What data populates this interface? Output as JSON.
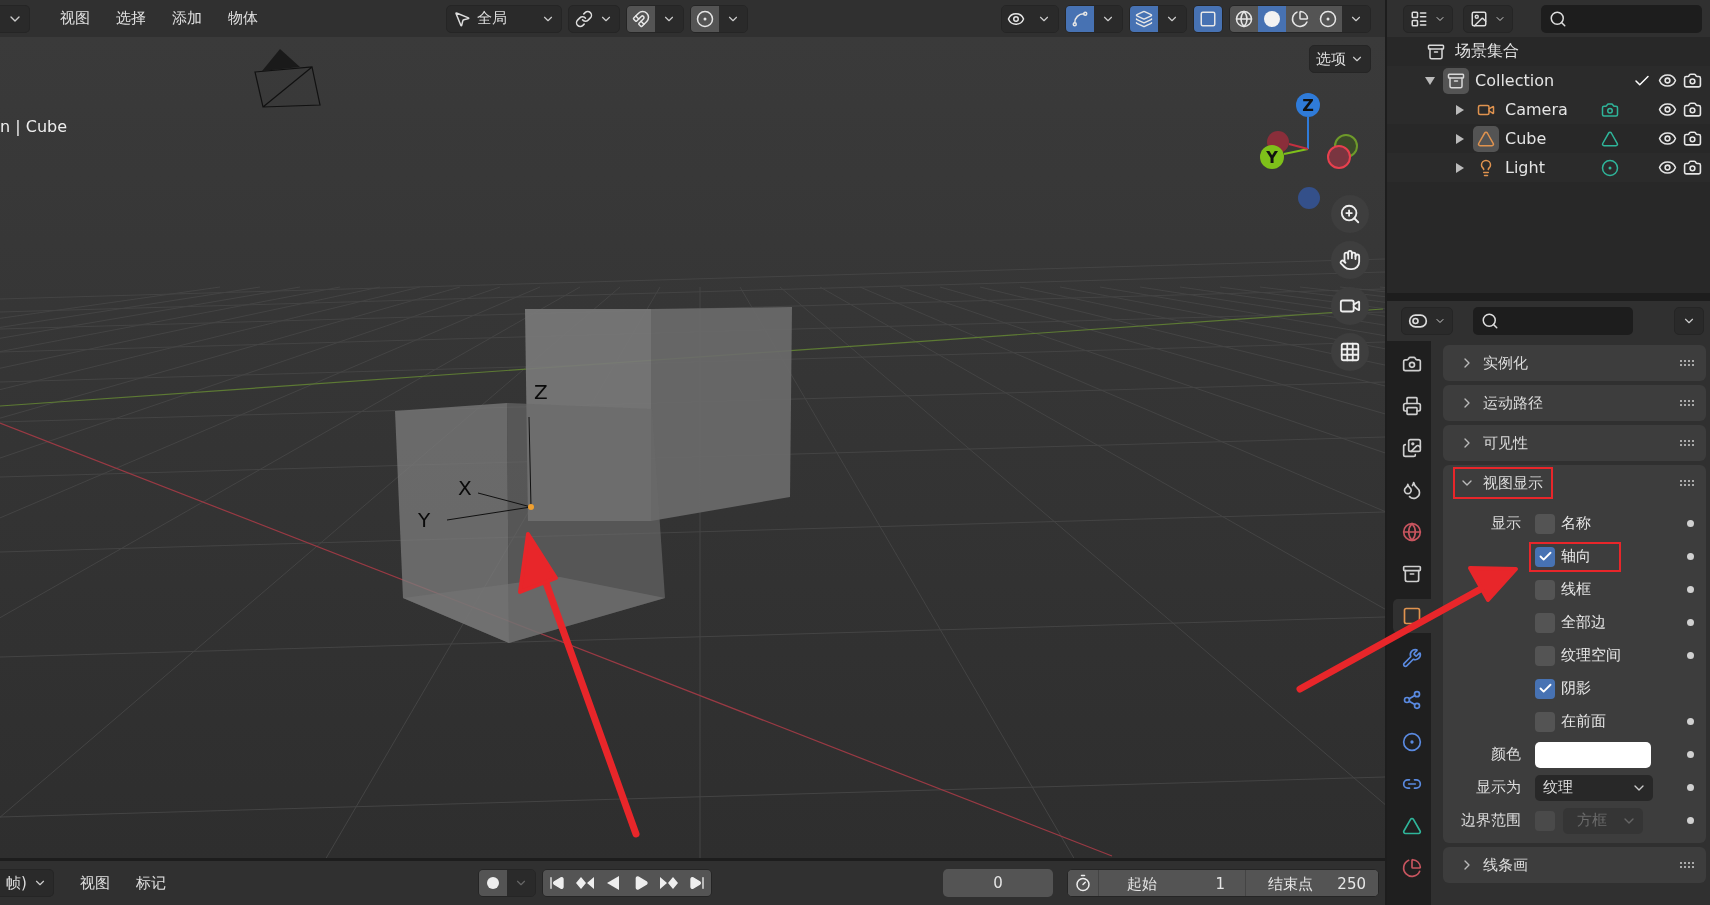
{
  "viewport": {
    "menus": [
      "视图",
      "选择",
      "添加",
      "物体"
    ],
    "orientation": "全局",
    "toggles": [
      {
        "kind": "snap",
        "on": false
      },
      {
        "kind": "proportional",
        "on": false
      },
      {
        "kind": "visibility",
        "on": false
      },
      {
        "kind": "gizmo",
        "on": true
      },
      {
        "kind": "overlays",
        "on": true
      },
      {
        "kind": "xray",
        "on": true
      }
    ],
    "shading": [
      {
        "kind": "wireframe",
        "selected": false
      },
      {
        "kind": "solid",
        "selected": true
      },
      {
        "kind": "material",
        "selected": false
      },
      {
        "kind": "rendered",
        "selected": false
      }
    ],
    "options_button": "选项",
    "object_label": "n | Cube",
    "object_axes": [
      "Z",
      "X",
      "Y"
    ],
    "gizmo_axes": [
      "Z",
      "Y"
    ]
  },
  "outliner": {
    "root": "场景集合",
    "items": [
      {
        "name": "Collection",
        "kind": "collection",
        "expanded": true,
        "checked": true,
        "active": true,
        "children": [
          {
            "name": "Camera",
            "kind": "camera",
            "expanded": false,
            "active": false
          },
          {
            "name": "Cube",
            "kind": "mesh",
            "expanded": false,
            "active": true
          },
          {
            "name": "Light",
            "kind": "light",
            "expanded": false,
            "active": false
          }
        ]
      }
    ]
  },
  "properties": {
    "tabs": [
      {
        "kind": "render",
        "selected": false
      },
      {
        "kind": "output",
        "selected": false
      },
      {
        "kind": "view_layer",
        "selected": false
      },
      {
        "kind": "scene",
        "selected": false
      },
      {
        "kind": "world",
        "selected": false
      },
      {
        "kind": "collection",
        "selected": false
      },
      {
        "kind": "object",
        "selected": true
      },
      {
        "kind": "modifiers",
        "selected": false
      },
      {
        "kind": "particles",
        "selected": false
      },
      {
        "kind": "physics",
        "selected": false
      },
      {
        "kind": "constraints",
        "selected": false
      },
      {
        "kind": "data",
        "selected": false
      },
      {
        "kind": "material",
        "selected": false
      }
    ],
    "sections": [
      {
        "title": "实例化",
        "expanded": false,
        "highlighted": false
      },
      {
        "title": "运动路径",
        "expanded": false,
        "highlighted": false
      },
      {
        "title": "可见性",
        "expanded": false,
        "highlighted": false
      },
      {
        "title": "视图显示",
        "expanded": true,
        "highlighted": true,
        "rows": [
          {
            "kind": "checkbox",
            "label": "显示",
            "text": "名称",
            "checked": false,
            "highlighted": false,
            "animatable": true
          },
          {
            "kind": "checkbox",
            "text": "轴向",
            "checked": true,
            "highlighted": true,
            "animatable": true
          },
          {
            "kind": "checkbox",
            "text": "线框",
            "checked": false,
            "highlighted": false,
            "animatable": true
          },
          {
            "kind": "checkbox",
            "text": "全部边",
            "checked": false,
            "highlighted": false,
            "animatable": true
          },
          {
            "kind": "checkbox",
            "text": "纹理空间",
            "checked": false,
            "highlighted": false,
            "animatable": true
          },
          {
            "kind": "checkbox",
            "text": "阴影",
            "checked": true,
            "highlighted": false,
            "animatable": false
          },
          {
            "kind": "checkbox",
            "text": "在前面",
            "checked": false,
            "highlighted": false,
            "animatable": true
          },
          {
            "kind": "color",
            "label": "颜色",
            "color": "#ffffff",
            "animatable": true
          },
          {
            "kind": "dropdown",
            "label": "显示为",
            "value": "纹理",
            "disabled": false,
            "animatable": true
          },
          {
            "kind": "checkbox_dropdown",
            "label": "边界范围",
            "checked": false,
            "value": "方框",
            "disabled": true,
            "animatable": true
          }
        ]
      },
      {
        "title": "线条画",
        "expanded": false,
        "highlighted": false
      }
    ]
  },
  "timeline": {
    "mode": "帧)",
    "menus": [
      "视图",
      "标记"
    ],
    "current_frame": "0",
    "start_label": "起始",
    "start": "1",
    "end_label": "结束点",
    "end": "250"
  }
}
